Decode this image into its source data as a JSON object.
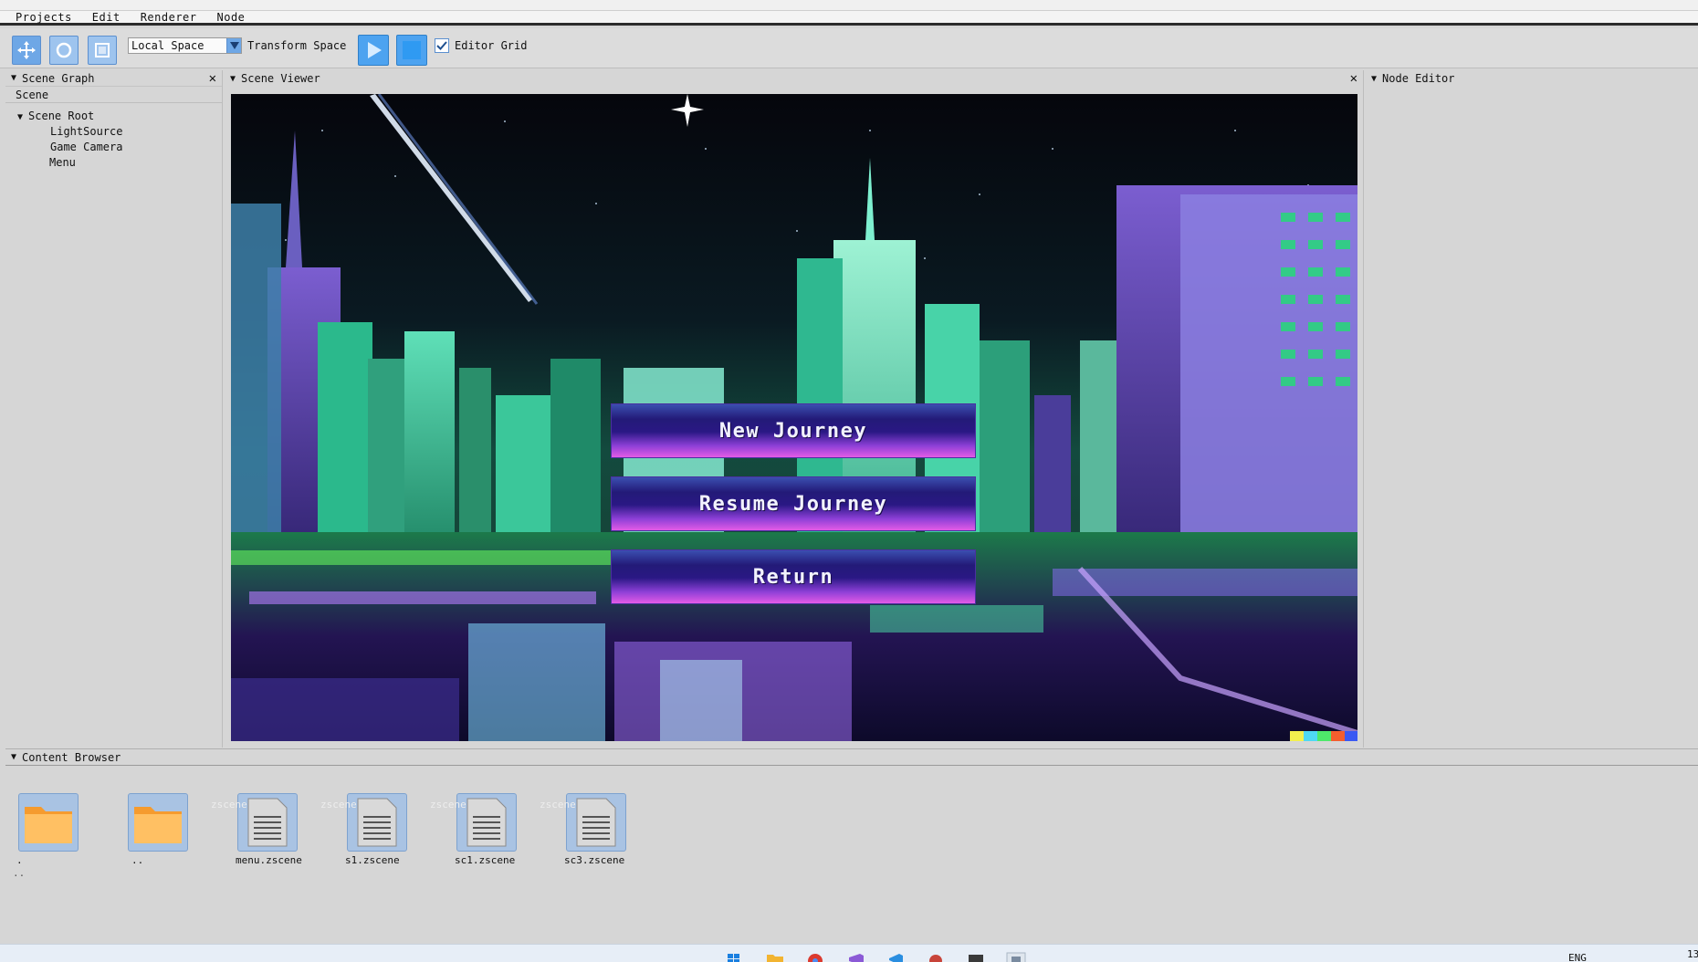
{
  "menubar": {
    "items": [
      "Projects",
      "Edit",
      "Renderer",
      "Node"
    ]
  },
  "toolbar": {
    "tools": [
      "move-tool-icon",
      "rotate-tool-icon",
      "scale-tool-icon"
    ],
    "space_select": "Local Space",
    "transform_label": "Transform Space",
    "editor_grid_label": "Editor Grid",
    "editor_grid_checked": true
  },
  "scene_graph": {
    "title": "Scene Graph",
    "tab": "Scene",
    "root": "Scene Root",
    "children": [
      "LightSource",
      "Game Camera",
      "Menu"
    ]
  },
  "scene_viewer": {
    "title": "Scene Viewer",
    "menu_buttons": [
      "New Journey",
      "Resume Journey",
      "Return"
    ]
  },
  "node_editor": {
    "title": "Node Editor"
  },
  "content_browser": {
    "title": "Content Browser",
    "items": [
      {
        "type": "folder",
        "name": "."
      },
      {
        "type": "folder",
        "name": ".."
      },
      {
        "type": "file",
        "name": "menu.zscene",
        "ghost": "zscene"
      },
      {
        "type": "file",
        "name": "s1.zscene",
        "ghost": "zscene"
      },
      {
        "type": "file",
        "name": "sc1.zscene",
        "ghost": "zscene"
      },
      {
        "type": "file",
        "name": "sc3.zscene",
        "ghost": "zscene"
      }
    ],
    "trailing": ".."
  },
  "taskbar": {
    "language": "ENG",
    "clock_fragment": "13"
  },
  "colors": {
    "accent": "#6ea7e6",
    "panel_bg": "#d6d6d6",
    "menu_btn_top": "#231a78",
    "menu_btn_bottom": "#e35be6"
  }
}
